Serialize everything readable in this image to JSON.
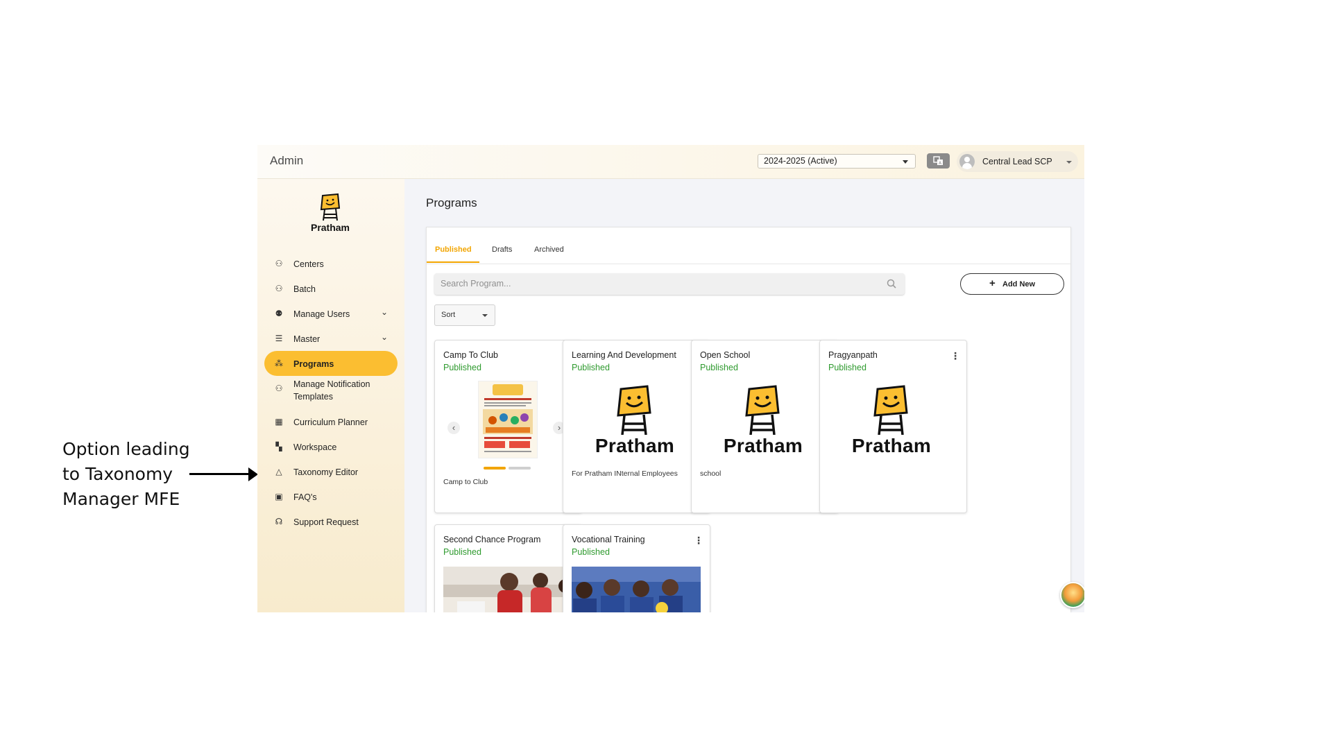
{
  "annotation": {
    "lines": [
      "Option leading",
      "to Taxonomy",
      "Manager MFE"
    ]
  },
  "topbar": {
    "title": "Admin",
    "academic_year": "2024-2025 (Active)",
    "user_name": "Central Lead SCP"
  },
  "sidebar": {
    "logo_text": "Pratham",
    "items": [
      {
        "label": "Centers",
        "icon": "center-icon"
      },
      {
        "label": "Batch",
        "icon": "batch-icon"
      },
      {
        "label": "Manage Users",
        "icon": "users-icon",
        "expandable": true
      },
      {
        "label": "Master",
        "icon": "database-icon",
        "expandable": true
      },
      {
        "label": "Programs",
        "icon": "programs-icon",
        "active": true
      },
      {
        "label": "Manage Notification Templates",
        "icon": "notification-icon"
      },
      {
        "label": "Curriculum Planner",
        "icon": "calendar-icon"
      },
      {
        "label": "Workspace",
        "icon": "workspace-icon"
      },
      {
        "label": "Taxonomy Editor",
        "icon": "taxonomy-icon",
        "highlighted": true
      },
      {
        "label": "FAQ's",
        "icon": "faq-icon"
      },
      {
        "label": "Support Request",
        "icon": "support-icon"
      }
    ]
  },
  "main": {
    "page_title": "Programs",
    "tabs": [
      {
        "label": "Published",
        "active": true
      },
      {
        "label": "Drafts"
      },
      {
        "label": "Archived"
      }
    ],
    "search_placeholder": "Search Program...",
    "add_new_label": "Add New",
    "sort_label": "Sort",
    "cards": [
      {
        "name": "Camp To Club",
        "status": "Published",
        "description": "Camp to Club",
        "media": "carousel-poster"
      },
      {
        "name": "Learning And Development",
        "status": "Published",
        "description": "For Pratham INternal Employees",
        "media": "pratham-logo"
      },
      {
        "name": "Open School",
        "status": "Published",
        "description": "school",
        "media": "pratham-logo"
      },
      {
        "name": "Pragyanpath",
        "status": "Published",
        "description": "",
        "media": "pratham-logo"
      },
      {
        "name": "Second Chance Program",
        "status": "Published",
        "description": "",
        "media": "photo"
      },
      {
        "name": "Vocational Training",
        "status": "Published",
        "description": "",
        "media": "photo"
      }
    ]
  },
  "colors": {
    "accent": "#fbbe31",
    "published": "#2e9a2e",
    "highlight": "#f7c6c6"
  }
}
